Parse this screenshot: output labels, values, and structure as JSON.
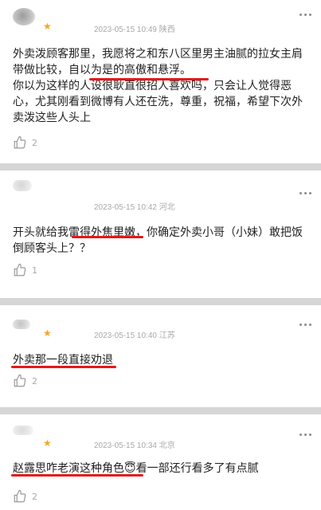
{
  "comments": [
    {
      "timestamp": "2023-05-15 10:49",
      "location": "陕西",
      "stars": 1,
      "content": "外卖泼顾客那里，我愿将之和东八区里男主油腻的拉女主肩带做比较，自以为是的高傲和悬浮。\n你以为这样的人设很耿直很招人喜欢吗，只会让人觉得恶心，尤其刚看到微博有人还在洗，尊重，祝福，希望下次外卖泼这些人头上",
      "likes": "2"
    },
    {
      "timestamp": "2023-05-15 10:42",
      "location": "河北",
      "stars": 0,
      "content": "开头就给我雷得外焦里嫩，你确定外卖小哥（小妹）敢把饭倒顾客头上？？",
      "likes": "1"
    },
    {
      "timestamp": "2023-05-15 10:40",
      "location": "江苏",
      "stars": 1,
      "content": "外卖那一段直接劝退",
      "likes": "2"
    },
    {
      "timestamp": "2023-05-15 10:34",
      "location": "北京",
      "stars": 1,
      "content": "赵露思咋老演这种角色😇看一部还行看多了有点腻",
      "likes": "2"
    }
  ],
  "colors": {
    "star": "#f5a623",
    "underline": "#e61818",
    "meta": "#a8a8a8"
  },
  "icons": {
    "like": "thumbs-up-icon",
    "more": "more-dots-icon"
  }
}
